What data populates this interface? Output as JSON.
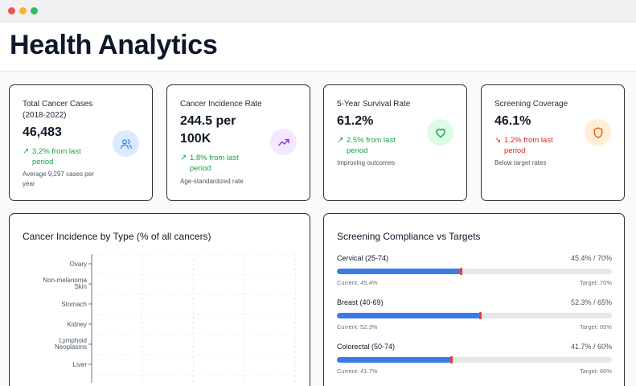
{
  "page": {
    "title": "Health Analytics"
  },
  "stats": [
    {
      "label": "Total Cancer Cases (2018-2022)",
      "value": "46,483",
      "trend": "3.2% from last period",
      "trend_direction": "up",
      "note": "Average 9,297 cases per year",
      "icon": "users-icon",
      "icon_color": "#3b82f6",
      "icon_bg": "#dbeafe"
    },
    {
      "label": "Cancer Incidence Rate",
      "value": "244.5 per 100K",
      "trend": "1.8% from last period",
      "trend_direction": "up",
      "note": "Age-standardized rate",
      "icon": "trending-up-icon",
      "icon_color": "#9333ea",
      "icon_bg": "#f3e8ff"
    },
    {
      "label": "5-Year Survival Rate",
      "value": "61.2%",
      "trend": "2.5% from last period",
      "trend_direction": "up",
      "note": "Improving outcomes",
      "icon": "heart-icon",
      "icon_color": "#16a34a",
      "icon_bg": "#dcfce7"
    },
    {
      "label": "Screening Coverage",
      "value": "46.1%",
      "trend": "1.2% from last period",
      "trend_direction": "down",
      "note": "Below target rates",
      "icon": "shield-icon",
      "icon_color": "#ea580c",
      "icon_bg": "#ffedd5"
    }
  ],
  "incidence_panel": {
    "title": "Cancer Incidence by Type (% of all cancers)"
  },
  "chart_data": {
    "type": "bar",
    "orientation": "horizontal",
    "categories": [
      "Ovary",
      "Non-melanoma Skin",
      "Stomach",
      "Kidney",
      "Lymphoid Neoplasms",
      "Liver"
    ],
    "values": [],
    "grid": true
  },
  "compliance_panel": {
    "title": "Screening Compliance vs Targets",
    "fill_color": "#3b7be8",
    "target_color": "#e0413a",
    "items": [
      {
        "name": "Cervical (25-74)",
        "value_text": "45.4% / 70%",
        "current": 45.4,
        "target": 70,
        "current_text": "Current: 45.4%",
        "target_text": "Target: 70%"
      },
      {
        "name": "Breast (40-69)",
        "value_text": "52.3% / 65%",
        "current": 52.3,
        "target": 65,
        "current_text": "Current: 52.3%",
        "target_text": "Target: 65%"
      },
      {
        "name": "Colorectal (50-74)",
        "value_text": "41.7% / 60%",
        "current": 41.7,
        "target": 60,
        "current_text": "Current: 41.7%",
        "target_text": "Target: 60%"
      }
    ]
  }
}
